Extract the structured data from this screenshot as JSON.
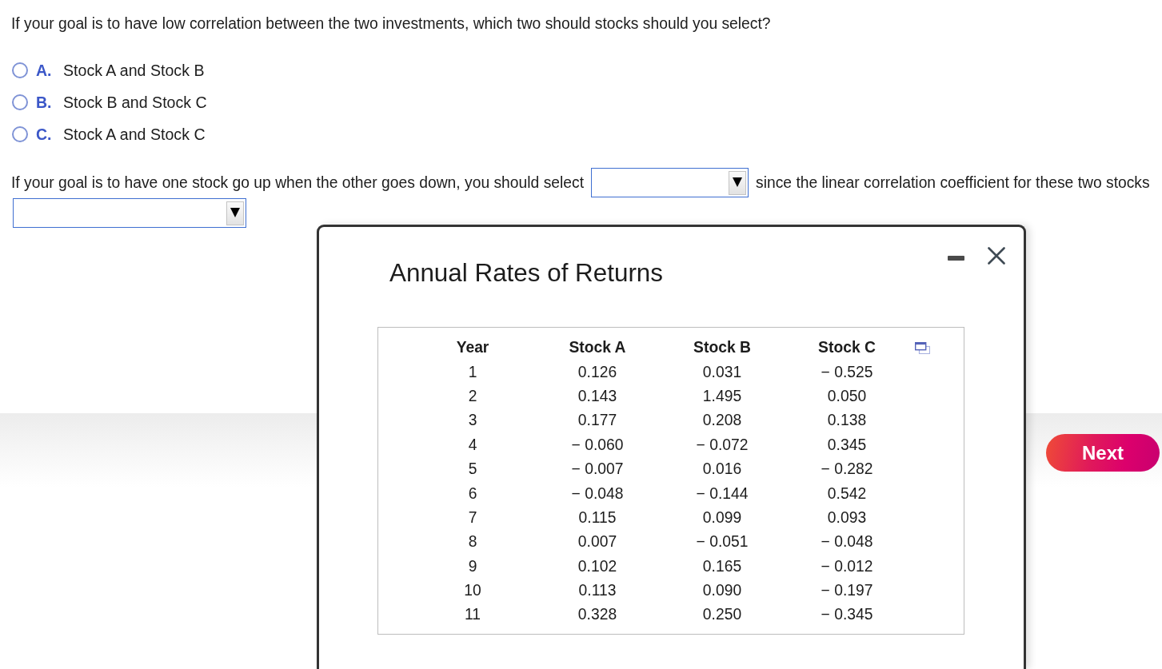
{
  "question_1": {
    "text": "If your goal is to have low correlation between the two investments, which two should stocks should you select?",
    "options": [
      {
        "letter": "A.",
        "text": "Stock A and Stock B",
        "selected": false
      },
      {
        "letter": "B.",
        "text": "Stock B and Stock C",
        "selected": false
      },
      {
        "letter": "C.",
        "text": "Stock A and Stock C",
        "selected": false
      }
    ]
  },
  "question_2": {
    "parts": [
      {
        "kind": "text",
        "text": "If your goal is to have one stock go up when the other goes down, you should select"
      },
      {
        "kind": "dropdown"
      },
      {
        "kind": "text",
        "text": "since the linear correlation coefficient for these two stocks"
      },
      {
        "kind": "dropdown"
      }
    ]
  },
  "popup": {
    "title": "Annual Rates of Returns",
    "table": {
      "columns": [
        "Year",
        "Stock A",
        "Stock B",
        "Stock C"
      ],
      "rows": [
        [
          "1",
          "0.126",
          "0.031",
          "− 0.525"
        ],
        [
          "2",
          "0.143",
          "1.495",
          "0.050"
        ],
        [
          "3",
          "0.177",
          "0.208",
          "0.138"
        ],
        [
          "4",
          "− 0.060",
          "− 0.072",
          "0.345"
        ],
        [
          "5",
          "− 0.007",
          "0.016",
          "− 0.282"
        ],
        [
          "6",
          "− 0.048",
          "− 0.144",
          "0.542"
        ],
        [
          "7",
          "0.115",
          "0.099",
          "0.093"
        ],
        [
          "8",
          "0.007",
          "− 0.051",
          "− 0.048"
        ],
        [
          "9",
          "0.102",
          "0.165",
          "− 0.012"
        ],
        [
          "10",
          "0.113",
          "0.090",
          "− 0.197"
        ],
        [
          "11",
          "0.328",
          "0.250",
          "− 0.345"
        ]
      ]
    }
  },
  "next_button": {
    "label": "Next"
  }
}
